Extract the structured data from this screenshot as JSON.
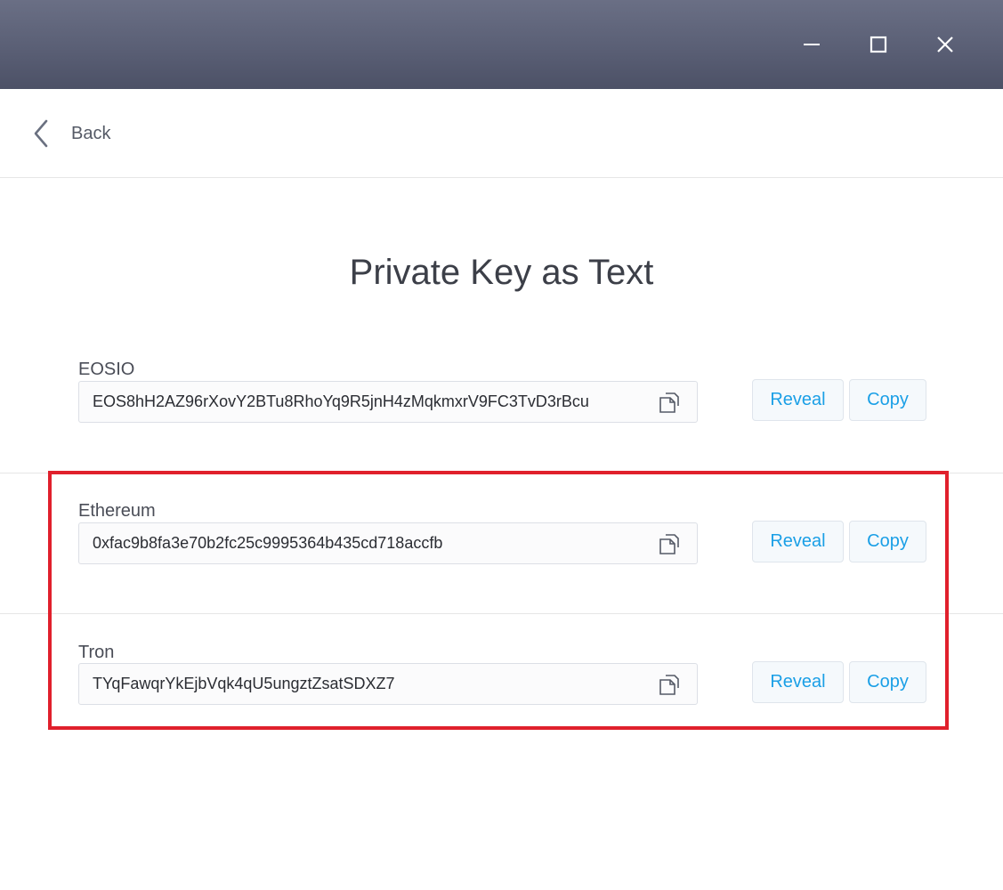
{
  "window": {
    "controls": [
      "minimize-icon",
      "maximize-icon",
      "close-icon"
    ],
    "titlebar_color": "#5a5f75"
  },
  "nav": {
    "back_label": "Back",
    "back_icon": "chevron-left-icon"
  },
  "page": {
    "title": "Private Key as Text"
  },
  "keys": [
    {
      "label": "EOSIO",
      "value": "EOS8hH2AZ96rXovY2BTu8RhoYq9R5jnH4zMqkmxrV9FC3TvD3rBcu",
      "reveal_label": "Reveal",
      "copy_label": "Copy"
    },
    {
      "label": "Ethereum",
      "value": "0xfac9b8fa3e70b2fc25c9995364b435cd718accfb",
      "reveal_label": "Reveal",
      "copy_label": "Copy"
    },
    {
      "label": "Tron",
      "value": "TYqFawqrYkEjbVqk4qU5ungztZsatSDXZ7",
      "reveal_label": "Reveal",
      "copy_label": "Copy"
    }
  ],
  "colors": {
    "accent": "#1a9fe6",
    "highlight": "#e0202c"
  }
}
